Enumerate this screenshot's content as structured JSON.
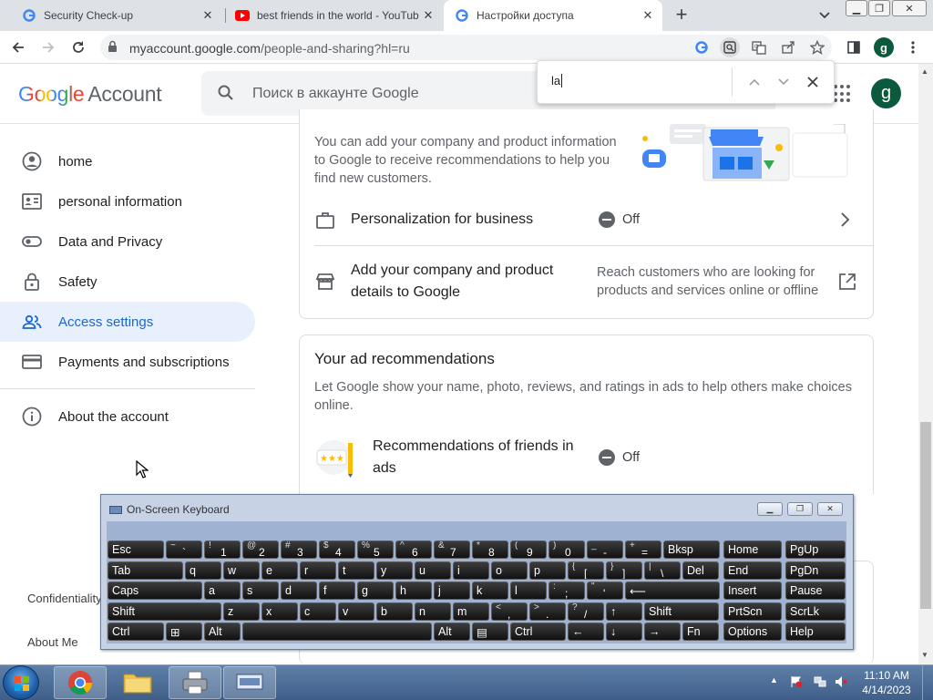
{
  "browser": {
    "tabs": [
      {
        "title": "Security Check-up"
      },
      {
        "title": "best friends in the world - YouTube"
      },
      {
        "title": "Настройки доступа"
      }
    ],
    "url_host": "myaccount.google.com",
    "url_path": "/people-and-sharing?hl=ru",
    "profile_initial": "g"
  },
  "findbar": {
    "query": "la"
  },
  "header": {
    "logo": "Google",
    "product": "Account",
    "search_placeholder": "Поиск в аккаунте Google",
    "avatar_initial": "g"
  },
  "sidebar": {
    "items": [
      {
        "label": "home"
      },
      {
        "label": "personal information"
      },
      {
        "label": "Data and Privacy"
      },
      {
        "label": "Safety"
      },
      {
        "label": "Access settings"
      },
      {
        "label": "Payments and subscriptions"
      },
      {
        "label": "About the account"
      }
    ],
    "footer": {
      "confidentiality": "Confidentiality",
      "about": "About Me"
    }
  },
  "business": {
    "description": "You can add your company and product information to Google to receive recommendations to help you find new customers.",
    "personalization": {
      "title": "Personalization for business",
      "status": "Off"
    },
    "add_details": {
      "title": "Add your company and product details to Google",
      "description": "Reach customers who are looking for products and services online or offline"
    }
  },
  "ads": {
    "title": "Your ad recommendations",
    "description": "Let Google show your name, photo, reviews, and ratings in ads to help others make choices online.",
    "friends": {
      "title": "Recommendations of friends in ads",
      "status": "Off"
    }
  },
  "osk": {
    "title": "On-Screen Keyboard",
    "rows": [
      [
        {
          "l": "Esc"
        },
        {
          "s": "~",
          "b": "`"
        },
        {
          "s": "!",
          "b": "1"
        },
        {
          "s": "@",
          "b": "2"
        },
        {
          "s": "#",
          "b": "3"
        },
        {
          "s": "$",
          "b": "4"
        },
        {
          "s": "%",
          "b": "5"
        },
        {
          "s": "^",
          "b": "6"
        },
        {
          "s": "&",
          "b": "7"
        },
        {
          "s": "*",
          "b": "8"
        },
        {
          "s": "(",
          "b": "9"
        },
        {
          "s": ")",
          "b": "0"
        },
        {
          "s": "_",
          "b": "-"
        },
        {
          "s": "+",
          "b": "="
        },
        {
          "l": "Bksp"
        },
        {
          "l": "Home"
        },
        {
          "l": "PgUp"
        }
      ],
      [
        {
          "l": "Tab"
        },
        {
          "l": "q"
        },
        {
          "l": "w"
        },
        {
          "l": "e"
        },
        {
          "l": "r"
        },
        {
          "l": "t"
        },
        {
          "l": "y"
        },
        {
          "l": "u"
        },
        {
          "l": "i"
        },
        {
          "l": "o"
        },
        {
          "l": "p"
        },
        {
          "s": "{",
          "b": "["
        },
        {
          "s": "}",
          "b": "]"
        },
        {
          "s": "|",
          "b": "\\"
        },
        {
          "l": "Del"
        },
        {
          "l": "End"
        },
        {
          "l": "PgDn"
        }
      ],
      [
        {
          "l": "Caps"
        },
        {
          "l": "a"
        },
        {
          "l": "s"
        },
        {
          "l": "d"
        },
        {
          "l": "f"
        },
        {
          "l": "g"
        },
        {
          "l": "h"
        },
        {
          "l": "j"
        },
        {
          "l": "k"
        },
        {
          "l": "l"
        },
        {
          "s": ":",
          "b": ";"
        },
        {
          "s": "\"",
          "b": "'"
        },
        {
          "l": "⟵"
        },
        {
          "l": "Insert"
        },
        {
          "l": "Pause"
        }
      ],
      [
        {
          "l": "Shift"
        },
        {
          "l": "z"
        },
        {
          "l": "x"
        },
        {
          "l": "c"
        },
        {
          "l": "v"
        },
        {
          "l": "b"
        },
        {
          "l": "n"
        },
        {
          "l": "m"
        },
        {
          "s": "<",
          "b": ","
        },
        {
          "s": ">",
          "b": "."
        },
        {
          "s": "?",
          "b": "/"
        },
        {
          "l": "↑"
        },
        {
          "l": "Shift"
        },
        {
          "l": "PrtScn"
        },
        {
          "l": "ScrLk"
        }
      ],
      [
        {
          "l": "Ctrl"
        },
        {
          "l": "⊞"
        },
        {
          "l": "Alt"
        },
        {
          "l": ""
        },
        {
          "l": "Alt"
        },
        {
          "l": "▤"
        },
        {
          "l": "Ctrl"
        },
        {
          "l": "←"
        },
        {
          "l": "↓"
        },
        {
          "l": "→"
        },
        {
          "l": "Fn"
        },
        {
          "l": "Options"
        },
        {
          "l": "Help"
        }
      ]
    ]
  },
  "taskbar": {
    "time": "11:10 AM",
    "date": "4/14/2023"
  },
  "colors": {
    "google_blue": "#4285f4",
    "google_red": "#ea4335",
    "google_yellow": "#fbbc05",
    "google_green": "#34a853",
    "active_nav_bg": "#e8f0fe",
    "active_nav_text": "#1967d2"
  }
}
